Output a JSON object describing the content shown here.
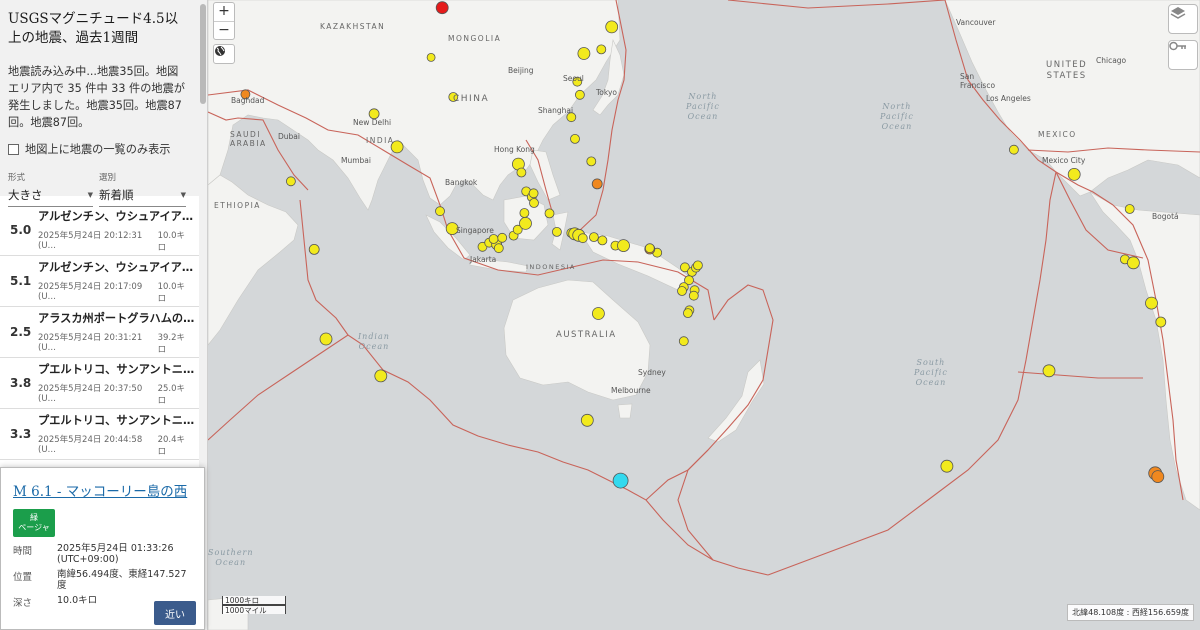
{
  "sidebar": {
    "title": "USGSマグニチュード4.5以上の地震、過去1週間",
    "status": "地震読み込み中...地震35回。地図エリア内で 35 件中 33 件の地震が発生しました。地震35回。地震87回。地震87回。",
    "list_only_label": "地図上に地震の一覧のみ表示",
    "format_label": "形式",
    "format_value": "大きさ",
    "sort_label": "選別",
    "sort_value": "新着順"
  },
  "quakes": [
    {
      "mag": "5.0",
      "place": "アルゼンチン、ウシュアイア…",
      "time": "2025年5月24日 20:12:31 (U…",
      "depth": "10.0キロ"
    },
    {
      "mag": "5.1",
      "place": "アルゼンチン、ウシュアイア…",
      "time": "2025年5月24日 20:17:09 (U…",
      "depth": "10.0キロ"
    },
    {
      "mag": "2.5",
      "place": "アラスカ州ポートグラハムの…",
      "time": "2025年5月24日 20:31:21 (U…",
      "depth": "39.2キロ"
    },
    {
      "mag": "3.8",
      "place": "プエルトリコ、サンアントニ…",
      "time": "2025年5月24日 20:37:50 (U…",
      "depth": "25.0キロ"
    },
    {
      "mag": "3.3",
      "place": "プエルトリコ、サンアントニ…",
      "time": "2025年5月24日 20:44:58 (U…",
      "depth": "20.4キロ"
    }
  ],
  "popup": {
    "title": "M 6.1 - マッコーリー島の西",
    "alert_line1": "緑",
    "alert_line2": "ページャ",
    "alert_color": "#1b9e4b",
    "time_label": "時間",
    "time_value_1": "2025年5月24日 01:33:26",
    "time_value_2": "(UTC+09:00)",
    "location_label": "位置",
    "location_value": "南緯56.494度、東経147.527度",
    "depth_label": "深さ",
    "depth_value": "10.0キロ",
    "nearby_button": "近い"
  },
  "map": {
    "zoom_in": "+",
    "zoom_out": "−",
    "scale_km": "1000キロ",
    "scale_mi": "1000マイル",
    "coordinates": "北緯48.108度 : 西経156.659度",
    "labels": {
      "kazakhstan": "KAZAKHSTAN",
      "mongolia": "MONGOLIA",
      "china": "CHINA",
      "beijing": "Beijing",
      "seoul": "Seoul",
      "tokyo": "Tokyo",
      "shanghai": "Shanghai",
      "hong_kong": "Hong Kong",
      "baghdad": "Baghdad",
      "dubai": "Dubai",
      "saudi_arabia": "SAUDI\nARABIA",
      "new_delhi": "New Delhi",
      "india": "INDIA",
      "mumbai": "Mumbai",
      "bangkok": "Bangkok",
      "ethiopia": "ETHIOPIA",
      "singapore": "Singapore",
      "jakarta": "Jakarta",
      "indonesia": "INDONESIA",
      "australia": "AUSTRALIA",
      "sydney": "Sydney",
      "melbourne": "Melbourne",
      "vancouver": "Vancouver",
      "united_states": "UNITED\nSTATES",
      "chicago": "Chicago",
      "san_francisco": "San\nFrancisco",
      "los_angeles": "Los Angeles",
      "mexico": "MEXICO",
      "mexico_city": "Mexico City",
      "bogota": "Bogotá",
      "north_pacific_ocean": "North\nPacific\nOcean",
      "north_pacific_ocean_2": "North\nPacific\nOcean",
      "indian_ocean": "Indian\nOcean",
      "south_pacific_ocean": "South\nPacific\nOcean",
      "southern_ocean": "Southern\nOcean"
    },
    "colors": {
      "land": "#f3f3f1",
      "water": "#d4d7d9",
      "plate_boundary": "#c8645a",
      "quake_yellow": "#f2ea1d",
      "quake_orange": "#f0881f",
      "quake_red": "#e51b1b",
      "quake_selected": "#33d9ee"
    }
  },
  "earthquakes": [
    {
      "lon": 99.3,
      "lat": 50.7,
      "color": "red",
      "size": 6
    },
    {
      "lon": 96.3,
      "lat": 41.4,
      "color": "yellow",
      "size": 4
    },
    {
      "lon": 102.3,
      "lat": 32.9,
      "color": "yellow",
      "size": 4.5
    },
    {
      "lon": 80.9,
      "lat": 29.0,
      "color": "yellow",
      "size": 5
    },
    {
      "lon": 46.1,
      "lat": 33.5,
      "color": "orange",
      "size": 4.5
    },
    {
      "lon": 87.1,
      "lat": 20.9,
      "color": "yellow",
      "size": 6
    },
    {
      "lon": 58.4,
      "lat": 12.0,
      "color": "yellow",
      "size": 4.5
    },
    {
      "lon": 64.7,
      "lat": -6.3,
      "color": "yellow",
      "size": 5
    },
    {
      "lon": 67.9,
      "lat": -29.2,
      "color": "yellow",
      "size": 6
    },
    {
      "lon": 98.7,
      "lat": 4.0,
      "color": "yellow",
      "size": 4.5
    },
    {
      "lon": 102.0,
      "lat": -0.7,
      "color": "yellow",
      "size": 6
    },
    {
      "lon": 110.2,
      "lat": -5.6,
      "color": "yellow",
      "size": 4.5
    },
    {
      "lon": 112.0,
      "lat": -4.5,
      "color": "yellow",
      "size": 4.5
    },
    {
      "lon": 114.0,
      "lat": -5.0,
      "color": "yellow",
      "size": 5
    },
    {
      "lon": 114.6,
      "lat": -6.0,
      "color": "yellow",
      "size": 4.5
    },
    {
      "lon": 113.2,
      "lat": -3.5,
      "color": "yellow",
      "size": 4.5
    },
    {
      "lon": 115.5,
      "lat": -3.2,
      "color": "yellow",
      "size": 4.5
    },
    {
      "lon": 118.6,
      "lat": -2.6,
      "color": "yellow",
      "size": 4.5
    },
    {
      "lon": 119.7,
      "lat": -1.0,
      "color": "yellow",
      "size": 4.5
    },
    {
      "lon": 121.8,
      "lat": 0.7,
      "color": "yellow",
      "size": 6
    },
    {
      "lon": 121.5,
      "lat": 3.5,
      "color": "yellow",
      "size": 4.5
    },
    {
      "lon": 119.9,
      "lat": 16.5,
      "color": "yellow",
      "size": 6
    },
    {
      "lon": 120.7,
      "lat": 14.3,
      "color": "yellow",
      "size": 4.5
    },
    {
      "lon": 122.0,
      "lat": 9.3,
      "color": "yellow",
      "size": 4.5
    },
    {
      "lon": 123.5,
      "lat": 7.8,
      "color": "yellow",
      "size": 4.5
    },
    {
      "lon": 124.0,
      "lat": 8.8,
      "color": "yellow",
      "size": 4.5
    },
    {
      "lon": 124.1,
      "lat": 6.2,
      "color": "yellow",
      "size": 4.5
    },
    {
      "lon": 128.3,
      "lat": 3.4,
      "color": "yellow",
      "size": 4.5
    },
    {
      "lon": 130.3,
      "lat": -1.6,
      "color": "yellow",
      "size": 4.5
    },
    {
      "lon": 134.2,
      "lat": -1.9,
      "color": "yellow",
      "size": 4.5
    },
    {
      "lon": 135.1,
      "lat": -2.1,
      "color": "yellow",
      "size": 6
    },
    {
      "lon": 136.2,
      "lat": -2.5,
      "color": "yellow",
      "size": 6
    },
    {
      "lon": 137.3,
      "lat": -3.3,
      "color": "yellow",
      "size": 4.5
    },
    {
      "lon": 140.3,
      "lat": -3.0,
      "color": "yellow",
      "size": 4.5
    },
    {
      "lon": 142.6,
      "lat": -3.9,
      "color": "yellow",
      "size": 4.5
    },
    {
      "lon": 146.1,
      "lat": -5.3,
      "color": "yellow",
      "size": 4.5
    },
    {
      "lon": 148.3,
      "lat": -5.3,
      "color": "yellow",
      "size": 6
    },
    {
      "lon": 157.4,
      "lat": -7.2,
      "color": "yellow",
      "size": 4.5
    },
    {
      "lon": 155.4,
      "lat": -6.2,
      "color": "orange",
      "size": 5
    },
    {
      "lon": 155.4,
      "lat": -6.0,
      "color": "yellow",
      "size": 4.5
    },
    {
      "lon": 136.5,
      "lat": 33.4,
      "color": "yellow",
      "size": 4.5
    },
    {
      "lon": 135.8,
      "lat": 36.3,
      "color": "yellow",
      "size": 4.5
    },
    {
      "lon": 137.6,
      "lat": 42.2,
      "color": "yellow",
      "size": 6
    },
    {
      "lon": 134.2,
      "lat": 28.2,
      "color": "yellow",
      "size": 4.5
    },
    {
      "lon": 135.2,
      "lat": 22.9,
      "color": "yellow",
      "size": 4.5
    },
    {
      "lon": 139.6,
      "lat": 17.2,
      "color": "yellow",
      "size": 4.5
    },
    {
      "lon": 141.2,
      "lat": 11.3,
      "color": "orange",
      "size": 5
    },
    {
      "lon": 141.5,
      "lat": -23.0,
      "color": "yellow",
      "size": 6
    },
    {
      "lon": 164.9,
      "lat": -11.1,
      "color": "yellow",
      "size": 4.5
    },
    {
      "lon": 166.8,
      "lat": -12.3,
      "color": "yellow",
      "size": 4.5
    },
    {
      "lon": 167.9,
      "lat": -11.2,
      "color": "yellow",
      "size": 4.5
    },
    {
      "lon": 168.4,
      "lat": -10.6,
      "color": "yellow",
      "size": 4.5
    },
    {
      "lon": 166.0,
      "lat": -14.5,
      "color": "yellow",
      "size": 4.5
    },
    {
      "lon": 164.6,
      "lat": -16.3,
      "color": "yellow",
      "size": 4.5
    },
    {
      "lon": 164.1,
      "lat": -17.3,
      "color": "yellow",
      "size": 4.5
    },
    {
      "lon": 167.5,
      "lat": -17.1,
      "color": "yellow",
      "size": 4.5
    },
    {
      "lon": 167.3,
      "lat": -18.5,
      "color": "yellow",
      "size": 4.5
    },
    {
      "lon": 166.1,
      "lat": -22.2,
      "color": "yellow",
      "size": 4.5
    },
    {
      "lon": 165.7,
      "lat": -22.9,
      "color": "yellow",
      "size": 4.5
    },
    {
      "lon": 164.6,
      "lat": -29.7,
      "color": "yellow",
      "size": 4.5
    },
    {
      "lon": 138.5,
      "lat": -46.4,
      "color": "yellow",
      "size": 6
    },
    {
      "lon": 147.5,
      "lat": -56.5,
      "color": "selected",
      "size": 7.5
    },
    {
      "lon": 82.7,
      "lat": -37.5,
      "color": "yellow",
      "size": 6
    },
    {
      "lon": 142.3,
      "lat": 43.0,
      "color": "yellow",
      "size": 4.5
    },
    {
      "lon": 145.1,
      "lat": 47.3,
      "color": "yellow",
      "size": 6
    },
    {
      "lon": 185.0,
      "lat": 55.0,
      "color": "yellow",
      "size": 5
    },
    {
      "lon": 253.8,
      "lat": 20.2,
      "color": "yellow",
      "size": 4.5
    },
    {
      "lon": 270.1,
      "lat": 13.8,
      "color": "yellow",
      "size": 6
    },
    {
      "lon": 285.1,
      "lat": 4.6,
      "color": "yellow",
      "size": 4.5
    },
    {
      "lon": 283.8,
      "lat": -9.0,
      "color": "yellow",
      "size": 4.5
    },
    {
      "lon": 286.1,
      "lat": -9.9,
      "color": "yellow",
      "size": 6
    },
    {
      "lon": 291.0,
      "lat": -20.4,
      "color": "yellow",
      "size": 6
    },
    {
      "lon": 293.5,
      "lat": -25.1,
      "color": "yellow",
      "size": 5
    },
    {
      "lon": 263.3,
      "lat": -36.4,
      "color": "yellow",
      "size": 6
    },
    {
      "lon": 235.7,
      "lat": -54.3,
      "color": "yellow",
      "size": 6
    },
    {
      "lon": 292.0,
      "lat": -55.4,
      "color": "orange",
      "size": 6.5
    },
    {
      "lon": 292.7,
      "lat": -55.9,
      "color": "orange",
      "size": 6
    }
  ]
}
